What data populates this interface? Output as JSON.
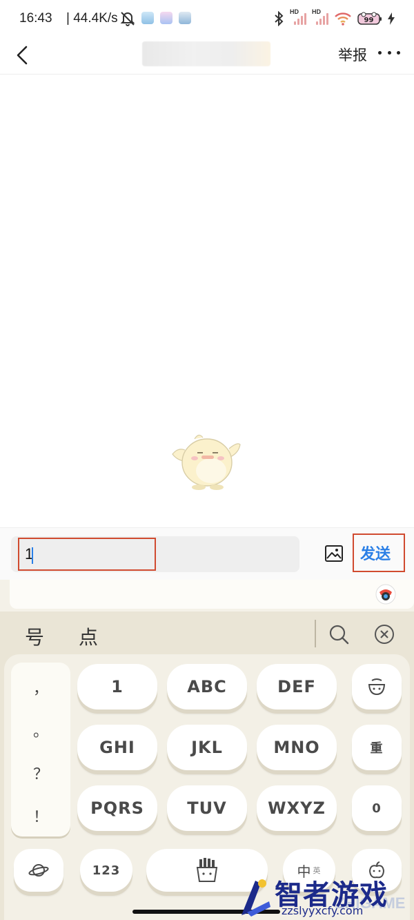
{
  "status_bar": {
    "time": "16:43",
    "network_speed": "| 44.4K/s",
    "signal_label_1": "HD",
    "signal_label_2": "HD",
    "battery_level": "99",
    "icons": [
      "mute-icon",
      "app-notification-icon",
      "bluetooth-icon",
      "signal-icon",
      "wifi-icon",
      "battery-icon",
      "charging-icon"
    ]
  },
  "nav": {
    "title": "",
    "report_label": "举报",
    "more_icon": "more-icon",
    "back_icon": "back-icon"
  },
  "composer": {
    "input_value": "1",
    "send_label": "发送",
    "image_icon": "image-icon"
  },
  "keyboard": {
    "candidates": [
      "号",
      "点"
    ],
    "punctuation": [
      "，",
      "。",
      "？",
      "！"
    ],
    "rows": [
      [
        "1",
        "ABC",
        "DEF"
      ],
      [
        "GHI",
        "JKL",
        "MNO"
      ],
      [
        "PQRS",
        "TUV",
        "WXYZ"
      ]
    ],
    "right_keys": [
      "重",
      "0"
    ],
    "bottom": {
      "num_label": "123",
      "lang_label": "中",
      "lang_sub": "英"
    },
    "accent": "#2a7fe6",
    "highlight_color": "#d04a2f"
  },
  "watermark": {
    "title": "智者游戏网",
    "url": "zzslyyxcfy.com",
    "ghost": "ZHIGAME"
  }
}
